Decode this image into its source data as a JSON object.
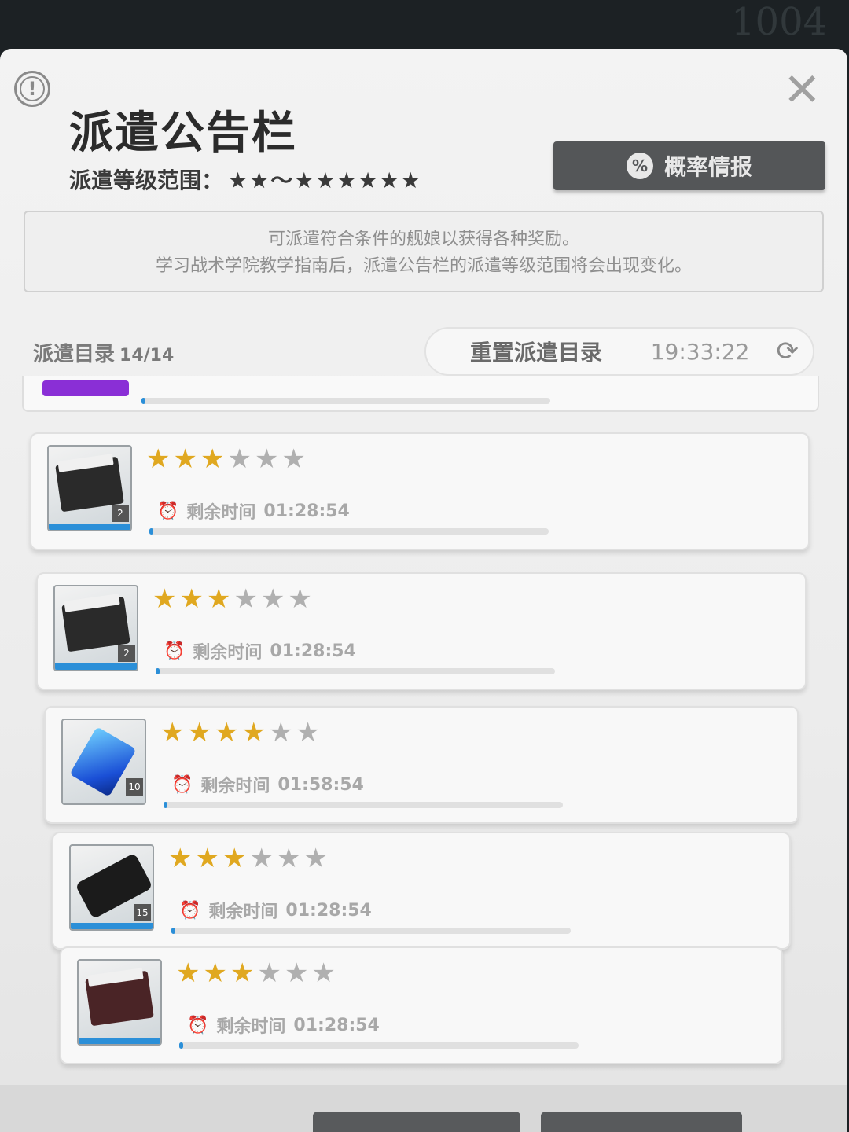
{
  "title": "派遣公告栏",
  "range": {
    "label": "派遣等级范围：",
    "stars_display": "★★～★★★★★★"
  },
  "probability_button": {
    "icon": "%",
    "label": "概率情报"
  },
  "notice": {
    "line1": "可派遣符合条件的舰娘以获得各种奖励。",
    "line2": "学习战术学院教学指南后，派遣公告栏的派遣等级范围将会出现变化。"
  },
  "list_header": {
    "label": "派遣目录",
    "count": "14/14",
    "reset_label": "重置派遣目录",
    "reset_time": "19:33:22"
  },
  "missions": [
    {
      "rating": 3,
      "max": 6,
      "timer_label": "剩余时间",
      "timer": "01:28:54",
      "item": "equipment-box",
      "progress": 0.01
    },
    {
      "rating": 3,
      "max": 6,
      "timer_label": "剩余时间",
      "timer": "01:28:54",
      "item": "equipment-box",
      "progress": 0.01
    },
    {
      "rating": 4,
      "max": 6,
      "timer_label": "剩余时间",
      "timer": "01:58:54",
      "item": "blue-gem",
      "progress": 0.01
    },
    {
      "rating": 3,
      "max": 6,
      "timer_label": "剩余时间",
      "timer": "01:28:54",
      "item": "black-device",
      "progress": 0.01
    },
    {
      "rating": 3,
      "max": 6,
      "timer_label": "剩余时间",
      "timer": "01:28:54",
      "item": "red-box",
      "progress": 0.01
    }
  ],
  "colors": {
    "accent_blue": "#2b8fd8",
    "star_gold": "#e0a820",
    "button_dark": "#545658",
    "purple_tag": "#8a2fd6"
  }
}
